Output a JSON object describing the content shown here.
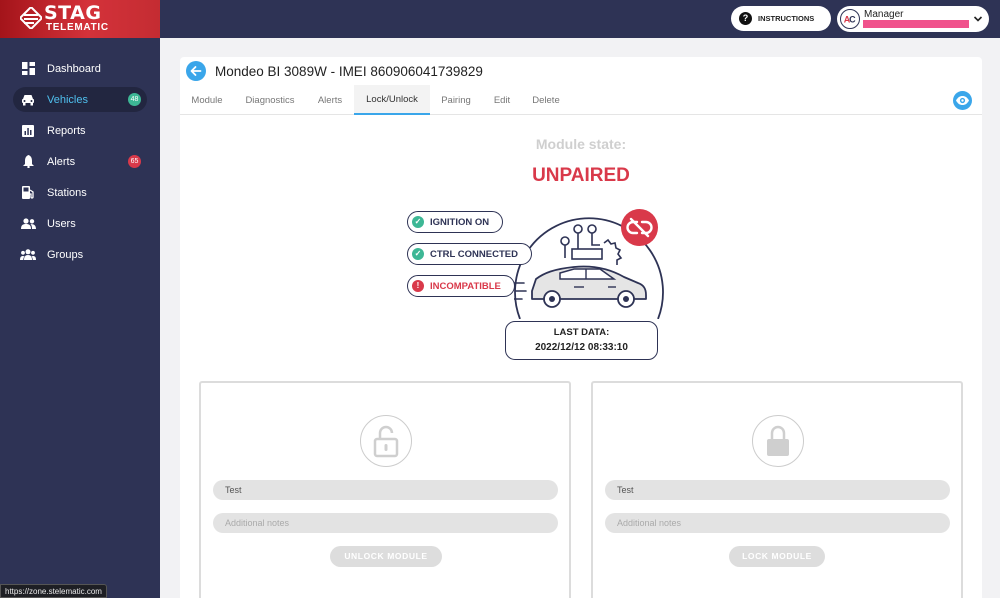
{
  "brand": {
    "name": "STAG",
    "sub": "TELEMATIC"
  },
  "colors": {
    "sidebar": "#2e3355",
    "accent": "#3aa6ea",
    "danger": "#d9394a",
    "success": "#3db795"
  },
  "sidebar": {
    "items": [
      {
        "label": "Dashboard",
        "icon": "dashboard-icon"
      },
      {
        "label": "Vehicles",
        "icon": "car-icon",
        "badge": "48",
        "active": true
      },
      {
        "label": "Reports",
        "icon": "reports-icon"
      },
      {
        "label": "Alerts",
        "icon": "bell-icon",
        "badge": "65"
      },
      {
        "label": "Stations",
        "icon": "station-icon"
      },
      {
        "label": "Users",
        "icon": "users-icon"
      },
      {
        "label": "Groups",
        "icon": "groups-icon"
      }
    ]
  },
  "header": {
    "instructions_label": "INSTRUCTIONS",
    "user_role": "Manager"
  },
  "vehicle": {
    "title": "Mondeo BI 3089W - IMEI 860906041739829"
  },
  "tabs": [
    {
      "label": "Module"
    },
    {
      "label": "Diagnostics"
    },
    {
      "label": "Alerts"
    },
    {
      "label": "Lock/Unlock",
      "active": true
    },
    {
      "label": "Pairing"
    },
    {
      "label": "Edit"
    },
    {
      "label": "Delete"
    }
  ],
  "module_state": {
    "label": "Module state:",
    "value": "UNPAIRED",
    "indicators": [
      {
        "label": "IGNITION ON",
        "status": "ok"
      },
      {
        "label": "CTRL CONNECTED",
        "status": "ok"
      },
      {
        "label": "INCOMPATIBLE",
        "status": "error"
      }
    ],
    "last_data_label": "LAST DATA:",
    "last_data_value": "2022/12/12 08:33:10"
  },
  "unlock_panel": {
    "name": "Test",
    "notes_placeholder": "Additional notes",
    "button_label": "UNLOCK MODULE"
  },
  "lock_panel": {
    "name": "Test",
    "notes_placeholder": "Additional notes",
    "button_label": "LOCK MODULE"
  },
  "statusbar": {
    "url": "https://zone.stelematic.com"
  }
}
